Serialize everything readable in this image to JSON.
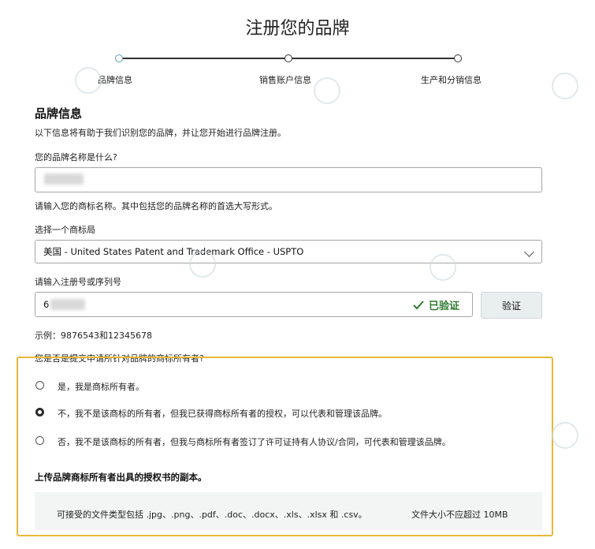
{
  "page": {
    "title": "注册您的品牌"
  },
  "steps": [
    {
      "label": "品牌信息",
      "state": "current"
    },
    {
      "label": "销售账户信息",
      "state": "upcoming"
    },
    {
      "label": "生产和分销信息",
      "state": "upcoming"
    }
  ],
  "section": {
    "title": "品牌信息",
    "description": "以下信息将有助于我们识别您的品牌，并让您开始进行品牌注册。"
  },
  "brand_name": {
    "label": "您的品牌名称是什么?",
    "value": "",
    "hint": "请输入您的商标名称。其中包括您的品牌名称的首选大写形式。"
  },
  "trademark_office": {
    "label": "选择一个商标局",
    "selected": "美国 - United States Patent and Trademark Office - USPTO"
  },
  "registration": {
    "label": "请输入注册号或序列号",
    "value": "6",
    "verified_icon": "check-icon",
    "verified_text": "已验证",
    "verify_button": "验证",
    "example": "示例：9876543和12345678"
  },
  "ownership": {
    "question": "您是否是提交申请所针对品牌的商标所有者?",
    "options": [
      {
        "label": "是，我是商标所有者。",
        "checked": false
      },
      {
        "label": "不，我不是该商标的所有者，但我已获得商标所有者的授权，可以代表和管理该品牌。",
        "checked": true
      },
      {
        "label": "否，我不是该商标的所有者，但我与商标所有者签订了许可证持有人协议/合同，可代表和管理该品牌。",
        "checked": false
      }
    ]
  },
  "upload": {
    "title": "上传品牌商标所有者出具的授权书的副本。",
    "accepted_types": "可接受的文件类型包括 .jpg、.png、.pdf、.doc、.docx、.xls、.xlsx 和 .csv。",
    "max_size": "文件大小不应超过 10MB"
  },
  "colors": {
    "highlight": "#e8b83a",
    "verified": "#2d7a2d",
    "current_step": "#5aa0a8"
  }
}
